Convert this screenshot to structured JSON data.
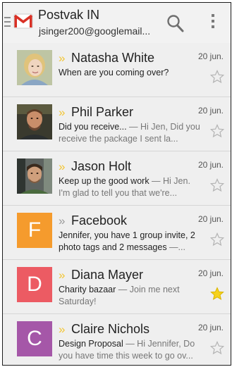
{
  "header": {
    "title": "Postvak IN",
    "account": "jsinger200@googlemail...",
    "search_icon": "search-icon",
    "overflow_icon": "overflow-menu-icon",
    "app_icon": "gmail-icon"
  },
  "colors": {
    "priority": "#f3c532",
    "star_on": "#f6d21c",
    "facebook_avatar": "#f59b2d",
    "diana_avatar": "#ec5b63",
    "claire_avatar": "#a557a8"
  },
  "messages": [
    {
      "sender": "Natasha White",
      "date": "20 jun.",
      "subject": "When are you coming over?",
      "snippet": "",
      "starred": false,
      "important": true,
      "avatar": "photo"
    },
    {
      "sender": "Phil Parker",
      "date": "20 jun.",
      "subject": "Did you receive...",
      "snippet": " — Hi Jen, Did you receive the package I sent la...",
      "starred": false,
      "important": true,
      "avatar": "photo"
    },
    {
      "sender": "Jason Holt",
      "date": "20 jun.",
      "subject": "Keep up the good work",
      "snippet": " — Hi Jen. I'm glad to tell you that we're...",
      "starred": false,
      "important": true,
      "avatar": "photo"
    },
    {
      "sender": "Facebook",
      "date": "20 jun.",
      "subject": "Jennifer, you have 1 group invite, 2 photo tags and 2 messages",
      "snippet": " —...",
      "starred": false,
      "important": false,
      "avatar": "F"
    },
    {
      "sender": "Diana Mayer",
      "date": "20 jun.",
      "subject": "Charity bazaar",
      "snippet": " — Join me next Saturday!",
      "starred": true,
      "important": true,
      "avatar": "D"
    },
    {
      "sender": "Claire Nichols",
      "date": "20 jun.",
      "subject": "Design Proposal",
      "snippet": " — Hi Jennifer, Do you have time this week to go ov...",
      "starred": false,
      "important": true,
      "avatar": "C"
    }
  ]
}
